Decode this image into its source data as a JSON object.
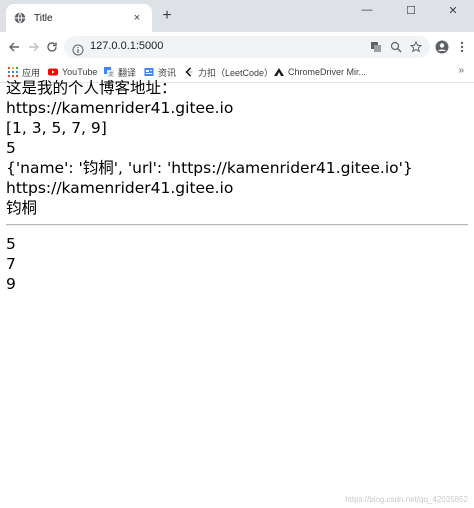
{
  "tab": {
    "title": "Title",
    "close": "×"
  },
  "window": {
    "minimize": "—",
    "maximize": "☐",
    "close": "✕",
    "new_tab": "+"
  },
  "toolbar": {
    "url": "127.0.0.1:5000"
  },
  "bookmarks": [
    {
      "label": "应用",
      "icon": "apps-grid-icon",
      "color": "#5f6368"
    },
    {
      "label": "YouTube",
      "icon": "youtube-icon",
      "color": "#ff0000"
    },
    {
      "label": "翻译",
      "icon": "translate-icon",
      "color": "#4285f4"
    },
    {
      "label": "资讯",
      "icon": "news-icon",
      "color": "#4285f4"
    },
    {
      "label": "力扣（LeetCode）",
      "icon": "leetcode-icon",
      "color": "#000000"
    },
    {
      "label": "ChromeDriver Mir...",
      "icon": "chromedriver-icon",
      "color": "#000000"
    }
  ],
  "content": {
    "line1": "这是我的个人博客地址：",
    "line2": "https://kamenrider41.gitee.io",
    "line3": "[1, 3, 5, 7, 9]",
    "line4": "5",
    "line5": "{'name': '钧桐', 'url': 'https://kamenrider41.gitee.io'}",
    "line6": "https://kamenrider41.gitee.io",
    "line7": "钧桐",
    "loop_items": [
      "5",
      "7",
      "9"
    ]
  },
  "watermark": "https://blog.csdn.net/qq_42035852"
}
